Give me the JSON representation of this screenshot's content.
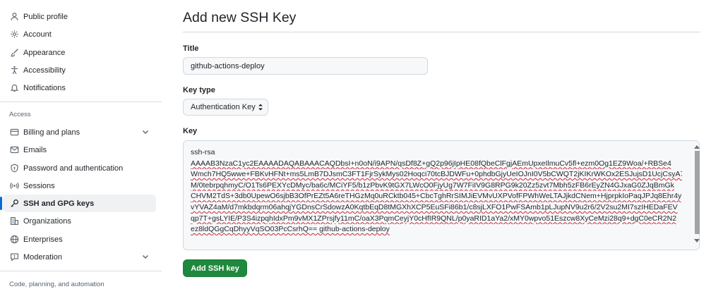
{
  "sidebar": {
    "items": [
      {
        "label": "Public profile",
        "icon": "person-icon"
      },
      {
        "label": "Account",
        "icon": "gear-icon"
      },
      {
        "label": "Appearance",
        "icon": "paintbrush-icon"
      },
      {
        "label": "Accessibility",
        "icon": "accessibility-icon"
      },
      {
        "label": "Notifications",
        "icon": "bell-icon"
      }
    ],
    "access_heading": "Access",
    "access_items": [
      {
        "label": "Billing and plans",
        "icon": "credit-card-icon"
      },
      {
        "label": "Emails",
        "icon": "mail-icon"
      },
      {
        "label": "Password and authentication",
        "icon": "shield-lock-icon"
      },
      {
        "label": "Sessions",
        "icon": "broadcast-icon"
      },
      {
        "label": "SSH and GPG keys",
        "icon": "key-icon"
      },
      {
        "label": "Organizations",
        "icon": "organization-icon"
      },
      {
        "label": "Enterprises",
        "icon": "globe-icon"
      },
      {
        "label": "Moderation",
        "icon": "report-icon"
      }
    ],
    "code_heading": "Code, planning, and automation"
  },
  "main": {
    "title": "Add new SSH Key",
    "title_label": "Title",
    "title_value": "github-actions-deploy",
    "key_type_label": "Key type",
    "key_type_value": "Authentication Key",
    "key_label": "Key",
    "key_lines": [
      "ssh-rsa",
      "AAAAB3NzaC1yc2EAAAADAQABAAACAQDbsI+n0oN/i9APN/qsDf8Z+gQ2p96jIpHE08fQbeClFgjAEmUpxeIlmuCv5fl+ezm0Og1EZ9Woa/+RBSe4",
      "Wmch7HQ5wwe+FBKvHFNt+ms5LmB7DJsmC3FT1FjrSykMys02Hoqci70tcBJDWFu+0phdbGjyUeIOJnI0V5bCWQT2jKIKrWKOx2ESJujsD1UcjCsyA7",
      "M/0tebrpqhmyC/O1Ts6PEXYcDMyc/ba6c/MCiYF5/b1zPbvK9tGX7LWcO0FjyUg7W7FiIV9G8RPG9k20Zz5zvt7Mbh5zFB6rEyZN4GJxaG0ZJqBmGk",
      "CHVM2TdS+3db0UpewO6sjbB3OfPrEZt5A6reTHGzMq0uRCktb045+CbcTghRrSIMJiEVMvUXPVofFPWhWeLTAJjkdCNem+HjprpkIoPaqJPJq8Ehr4y",
      "vYVAZ4aM/d7mkbdqrm06ahqjYGDnsCrSdowzA0KqtbEqD8tMGXhXCP5EuSFi86b1/c8sjLXFO1PwFSAmb1pLJupNV9u2r6/2V2su2MI7szIHEDaFEV",
      "qp7T+gsLYIE/P3S4izpqhIdxPm9vMX1ZPrsjfy11mC/oaX3PqmCeyjY0cHfIR9QNL/p0yaRID1aYa2/xMY0wpvo51Eszcw8XyCeMzi28q9+dgC0eCR2N2",
      "ez8ldQGgCqDhyyVqSO03PcCsrhQ== github-actions-deploy"
    ],
    "submit_label": "Add SSH key"
  },
  "colors": {
    "accent": "#0969da",
    "primary_button": "#1f883d",
    "spellcheck": "#cf222e"
  }
}
